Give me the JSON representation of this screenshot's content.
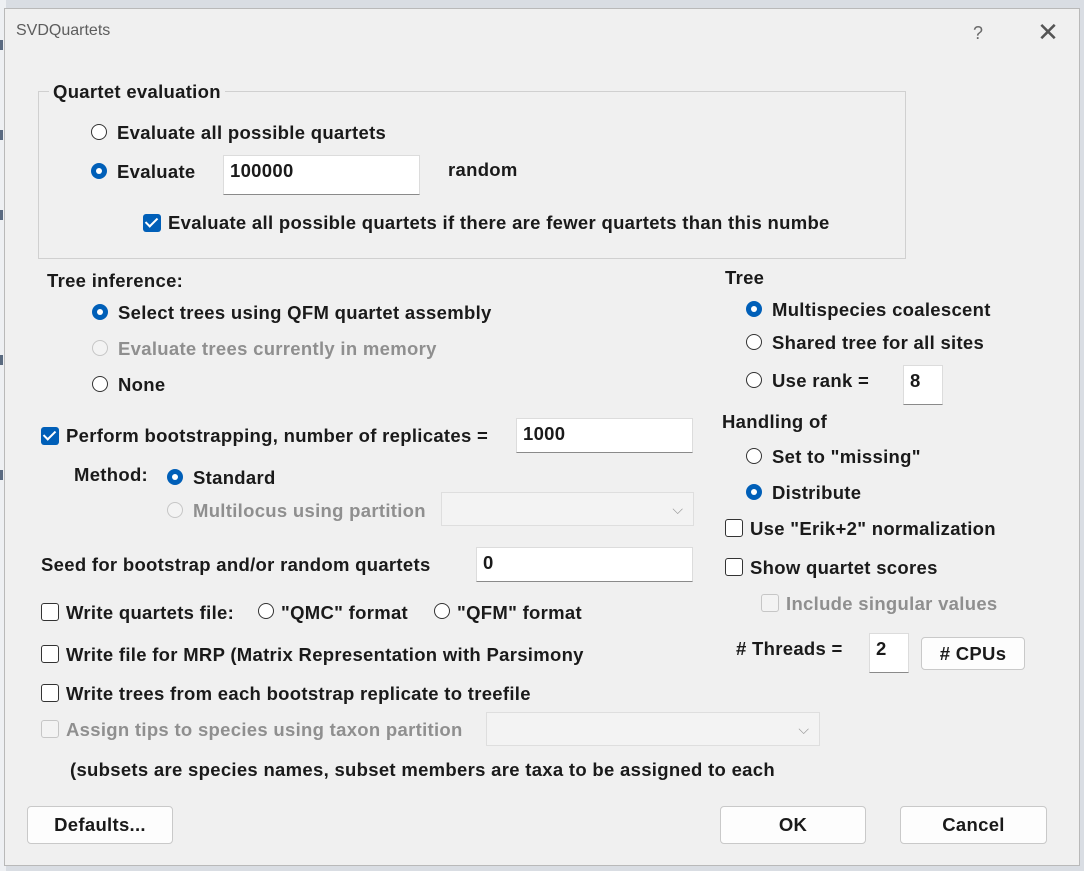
{
  "window": {
    "title": "SVDQuartets",
    "help_label": "?",
    "close_label": "✕"
  },
  "quartet_evaluation": {
    "title": "Quartet evaluation",
    "all_label": "Evaluate all possible quartets",
    "random_prefix": "Evaluate",
    "random_value": "100000",
    "random_suffix": "random",
    "fewer_label": "Evaluate all possible quartets if there are fewer quartets than this numbe"
  },
  "tree_inference": {
    "title": "Tree inference:",
    "qfm_label": "Select trees using QFM quartet assembly",
    "memory_label": "Evaluate trees currently in memory",
    "none_label": "None"
  },
  "tree": {
    "title": "Tree",
    "multispecies_label": "Multispecies coalescent",
    "shared_label": "Shared tree for all sites",
    "rank_label": "Use rank =",
    "rank_value": "8"
  },
  "handling": {
    "title": "Handling of",
    "missing_label": "Set to \"missing\"",
    "distribute_label": "Distribute",
    "erik_label": "Use \"Erik+2\" normalization",
    "scores_label": "Show quartet scores",
    "singular_label": "Include singular values"
  },
  "bootstrap": {
    "label": "Perform bootstrapping, number of replicates =",
    "replicates": "1000",
    "method_label": "Method:",
    "standard_label": "Standard",
    "multilocus_label": "Multilocus using partition"
  },
  "seed": {
    "label": "Seed for bootstrap and/or random quartets",
    "value": "0"
  },
  "output": {
    "quartets_label": "Write quartets file:",
    "qmc_label": "\"QMC\" format",
    "qfm_label": "\"QFM\" format",
    "mrp_label": "Write file for MRP (Matrix Representation with Parsimony",
    "trees_label": "Write trees from each bootstrap replicate to treefile",
    "assign_label": "Assign tips to species using taxon partition",
    "subsets_note": "(subsets are species names, subset members are taxa to be assigned to each"
  },
  "threads": {
    "label": "# Threads =",
    "value": "2",
    "cpus_label": "# CPUs"
  },
  "buttons": {
    "defaults": "Defaults...",
    "ok": "OK",
    "cancel": "Cancel"
  },
  "colors": {
    "accent": "#005fb8",
    "dialog_bg": "#f0f0f0",
    "disabled_text": "#8f8f8f"
  }
}
